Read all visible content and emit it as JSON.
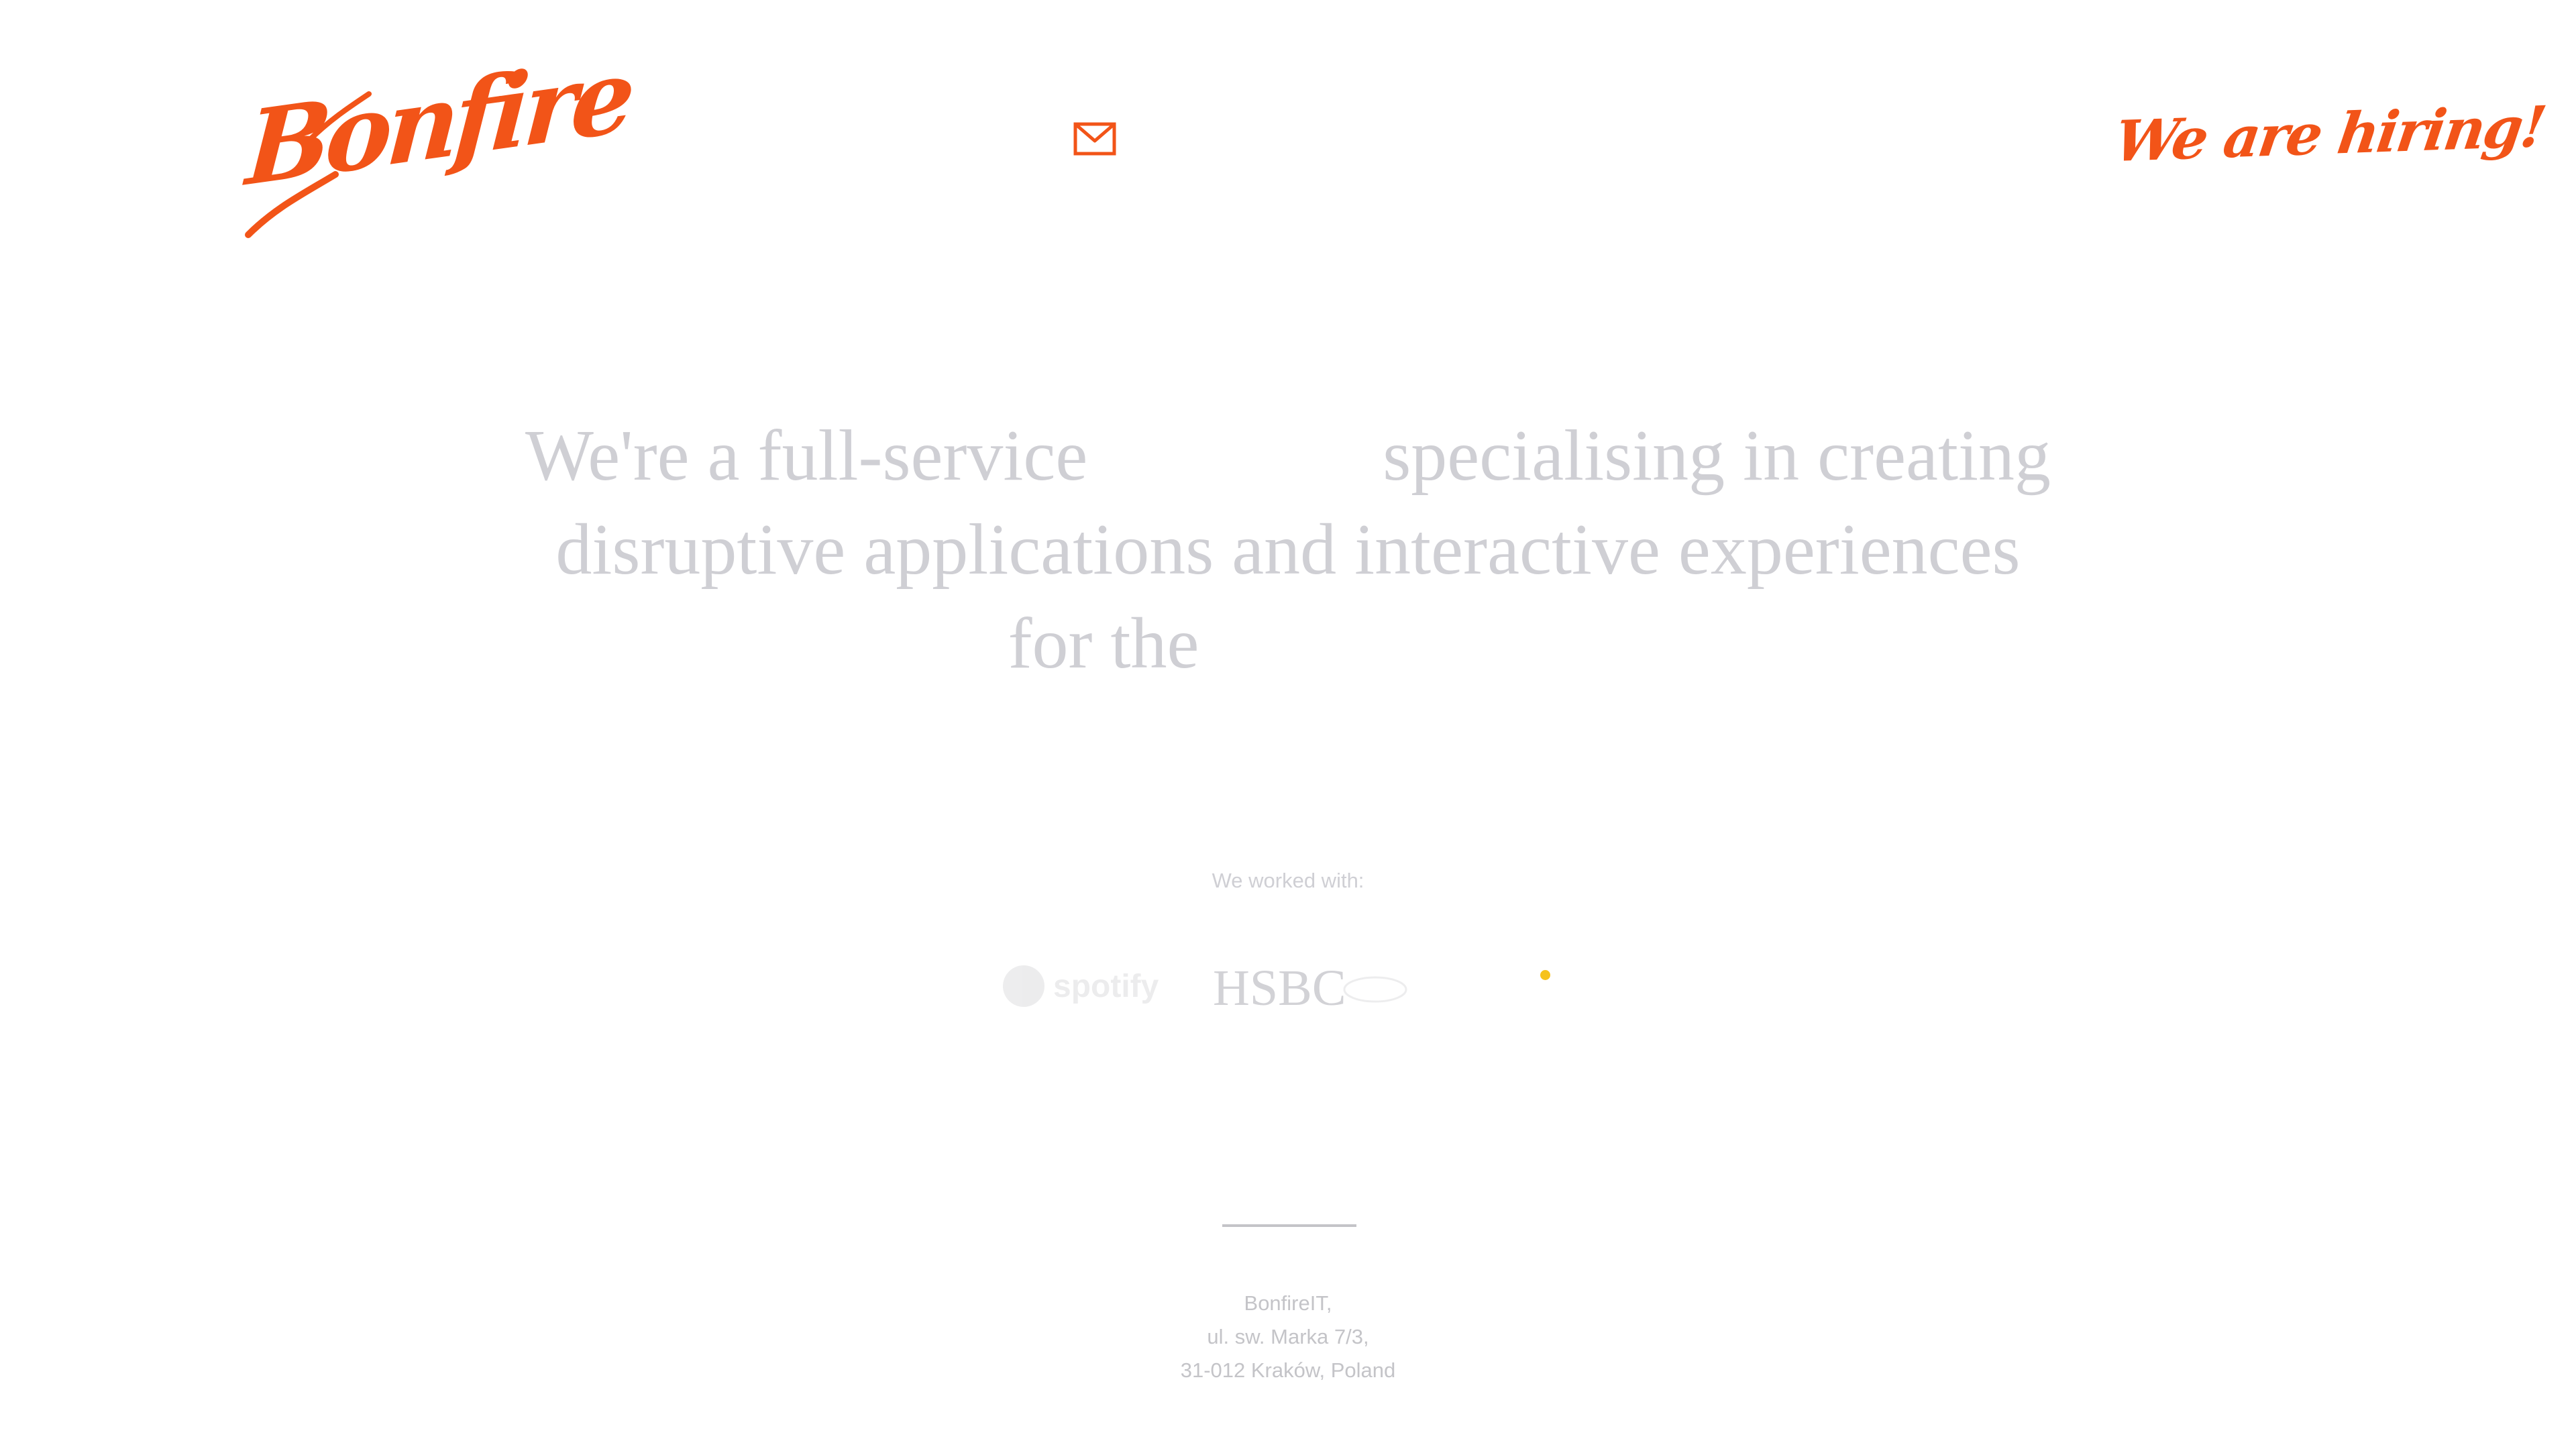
{
  "header": {
    "logo_text": "Bonfire",
    "mail_icon": "mail-icon",
    "hiring_label": "We are hiring!"
  },
  "hero": {
    "line1_part1": "We're a full-service",
    "line1_part2": "specialising in creating",
    "line2": "disruptive applications and interactive experiences",
    "line3": "for the"
  },
  "clients": {
    "heading": "We worked with:",
    "logos": [
      "spotify",
      "HSBC"
    ]
  },
  "footer": {
    "address_line1": "BonfireIT,",
    "address_line2": "ul. sw. Marka 7/3,",
    "address_line3": "31-012 Kraków, Poland"
  },
  "colors": {
    "brand_orange": "#f25418",
    "text_light": "#cfcfd4",
    "loader": "#f6c21b"
  }
}
